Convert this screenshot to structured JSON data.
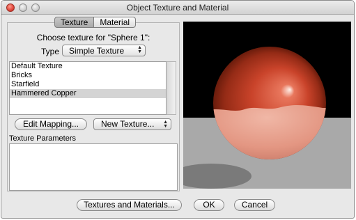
{
  "window": {
    "title": "Object Texture and Material"
  },
  "tabs": [
    {
      "label": "Texture",
      "selected": true
    },
    {
      "label": "Material",
      "selected": false
    }
  ],
  "texture_panel": {
    "choose_label": "Choose texture for \"Sphere 1\":",
    "type_label": "Type",
    "type_value": "Simple Texture",
    "textures": [
      "Default Texture",
      "Bricks",
      "Starfield",
      "Hammered Copper"
    ],
    "selected_texture": "Hammered Copper",
    "edit_mapping_label": "Edit Mapping...",
    "new_texture_label": "New Texture...",
    "parameters_label": "Texture Parameters"
  },
  "footer": {
    "textures_materials_label": "Textures and Materials...",
    "ok_label": "OK",
    "cancel_label": "Cancel"
  },
  "colors": {
    "preview_background": "#000000",
    "preview_floor": "#a9a9a9",
    "sphere_base": "#c0391f",
    "sphere_band": "#e79a86"
  }
}
